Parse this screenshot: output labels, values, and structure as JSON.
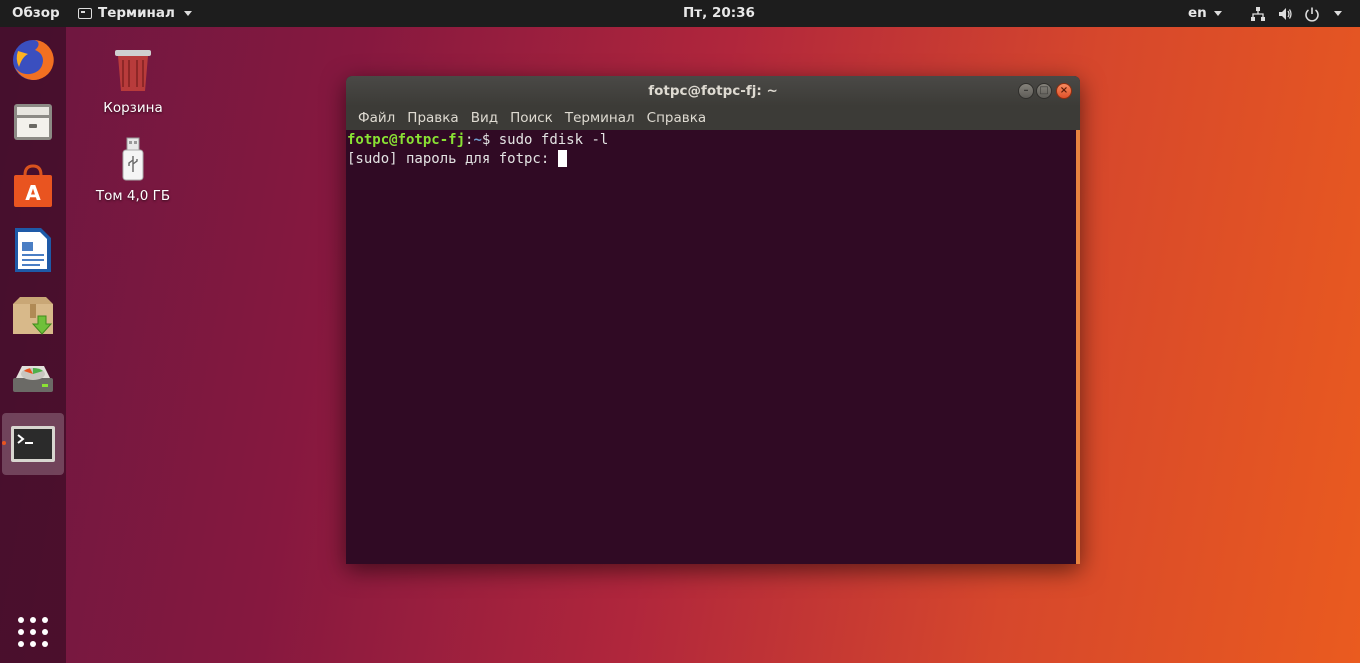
{
  "topbar": {
    "overview": "Обзор",
    "app_menu": "Терминал",
    "clock": "Пт, 20:36",
    "language": "en"
  },
  "dock": {
    "items": [
      {
        "name": "Firefox"
      },
      {
        "name": "Files"
      },
      {
        "name": "Ubuntu Software"
      },
      {
        "name": "LibreOffice Writer"
      },
      {
        "name": "Archive Manager"
      },
      {
        "name": "Disks"
      },
      {
        "name": "Terminal",
        "active": true
      }
    ]
  },
  "desktop": {
    "icons": [
      {
        "label": "Корзина"
      },
      {
        "label": "Том 4,0 ГБ"
      }
    ]
  },
  "window": {
    "title": "fotpc@fotpc-fj: ~",
    "menu": [
      "Файл",
      "Правка",
      "Вид",
      "Поиск",
      "Терминал",
      "Справка"
    ],
    "terminal": {
      "user_host": "fotpc@fotpc-fj",
      "separator": ":",
      "path": "~",
      "prompt_symbol": "$ ",
      "command": "sudo fdisk -l",
      "line2": "[sudo] пароль для fotpc: "
    }
  },
  "colors": {
    "terminal_bg": "#300a24",
    "prompt_user": "#8ae234",
    "prompt_path": "#729fcf",
    "accent": "#e95420"
  }
}
